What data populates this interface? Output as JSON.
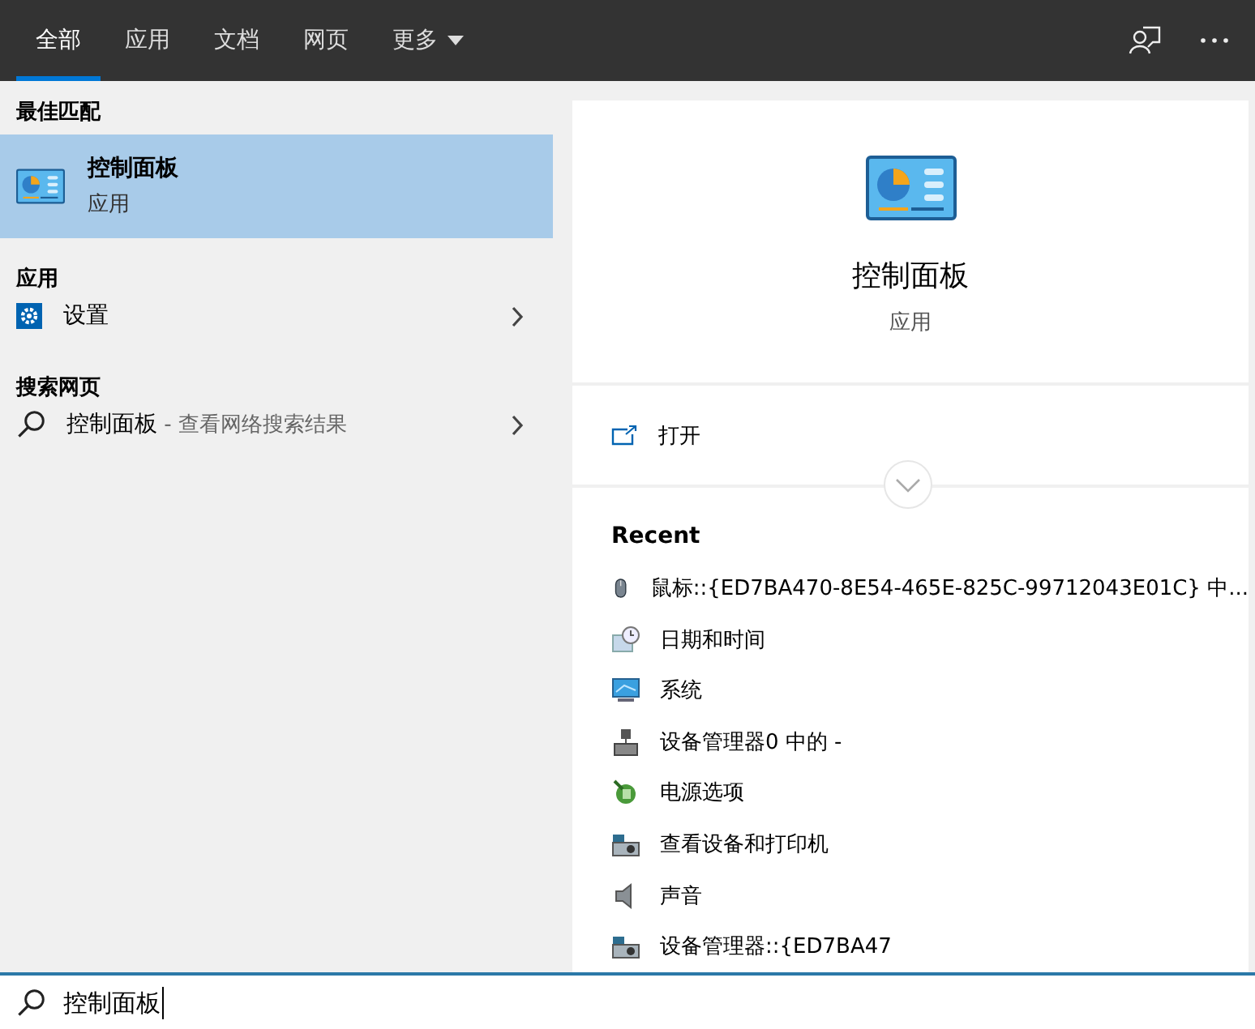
{
  "tabs": [
    {
      "label": "全部",
      "selected": true,
      "kind": "plain"
    },
    {
      "label": "应用",
      "selected": false,
      "kind": "plain"
    },
    {
      "label": "文档",
      "selected": false,
      "kind": "plain"
    },
    {
      "label": "网页",
      "selected": false,
      "kind": "plain"
    },
    {
      "label": "更多",
      "selected": false,
      "kind": "dropdown"
    }
  ],
  "results": {
    "best_match_heading": "最佳匹配",
    "best_match": {
      "title": "控制面板",
      "subtitle": "应用",
      "selected": true
    },
    "sections": [
      {
        "heading": "应用",
        "items": [
          {
            "kind": "app",
            "label": "设置"
          }
        ]
      },
      {
        "heading": "搜索网页",
        "items": [
          {
            "kind": "web",
            "label": "控制面板",
            "hint": " - 查看网络搜索结果"
          }
        ]
      }
    ]
  },
  "detail": {
    "title": "控制面板",
    "subtitle": "应用",
    "actions": [
      {
        "label": "打开"
      }
    ],
    "recent_heading": "Recent",
    "recent": [
      {
        "kind": "mouse",
        "label": "鼠标::{ED7BA470-8E54-465E-825C-99712043E01C} 中..."
      },
      {
        "kind": "clock",
        "label": "日期和时间"
      },
      {
        "kind": "monitor",
        "label": "系统"
      },
      {
        "kind": "network",
        "label": "设备管理器0 中的 -"
      },
      {
        "kind": "power",
        "label": "电源选项"
      },
      {
        "kind": "printer",
        "label": "查看设备和打印机"
      },
      {
        "kind": "speaker",
        "label": "声音"
      },
      {
        "kind": "printer",
        "label": "设备管理器::{ED7BA47"
      }
    ]
  },
  "search": {
    "value": "控制面板"
  }
}
